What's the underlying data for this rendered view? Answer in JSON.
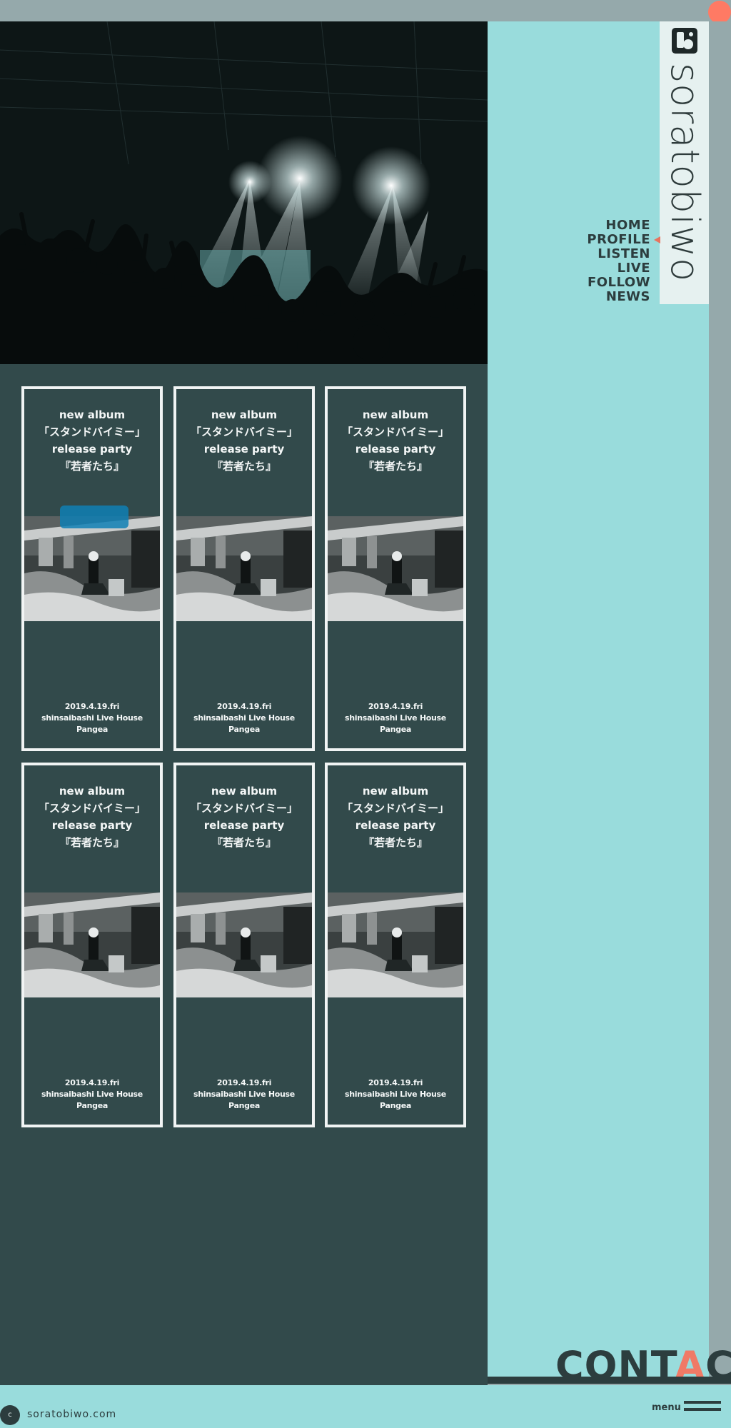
{
  "brand": {
    "name": "soratobiwo",
    "domain": "soratobiwo.com",
    "badge_letter": "c",
    "colors": {
      "accent": "#f07a66",
      "side_panel": "#99dcdc",
      "main": "#324a4b",
      "dark": "#2c3d3e"
    }
  },
  "nav": {
    "items": [
      {
        "label": "HOME"
      },
      {
        "label": "PROFILE",
        "active": true
      },
      {
        "label": "LISTEN"
      },
      {
        "label": "LIVE"
      },
      {
        "label": "FOLLOW"
      },
      {
        "label": "NEWS"
      }
    ]
  },
  "events": [
    {
      "title_lines": [
        "new album",
        "「スタンドバイミー」",
        "release party",
        "『若者たち』"
      ],
      "date": "2019.4.19.fri",
      "venue_lines": [
        "shinsaibashi Live House",
        "Pangea"
      ]
    },
    {
      "title_lines": [
        "new album",
        "「スタンドバイミー」",
        "release party",
        "『若者たち』"
      ],
      "date": "2019.4.19.fri",
      "venue_lines": [
        "shinsaibashi Live House",
        "Pangea"
      ]
    },
    {
      "title_lines": [
        "new album",
        "「スタンドバイミー」",
        "release party",
        "『若者たち』"
      ],
      "date": "2019.4.19.fri",
      "venue_lines": [
        "shinsaibashi Live House",
        "Pangea"
      ]
    },
    {
      "title_lines": [
        "new album",
        "「スタンドバイミー」",
        "release party",
        "『若者たち』"
      ],
      "date": "2019.4.19.fri",
      "venue_lines": [
        "shinsaibashi Live House",
        "Pangea"
      ]
    },
    {
      "title_lines": [
        "new album",
        "「スタンドバイミー」",
        "release party",
        "『若者たち』"
      ],
      "date": "2019.4.19.fri",
      "venue_lines": [
        "shinsaibashi Live House",
        "Pangea"
      ]
    },
    {
      "title_lines": [
        "new album",
        "「スタンドバイミー」",
        "release party",
        "『若者たち』"
      ],
      "date": "2019.4.19.fri",
      "venue_lines": [
        "shinsaibashi Live House",
        "Pangea"
      ]
    }
  ],
  "contact": {
    "prefix": "CONT",
    "accent_letter": "A",
    "suffix": "CT"
  },
  "footer": {
    "menu_label": "menu"
  },
  "icons": {
    "hamburger": "menu-icon",
    "logo": "logo-icon"
  }
}
